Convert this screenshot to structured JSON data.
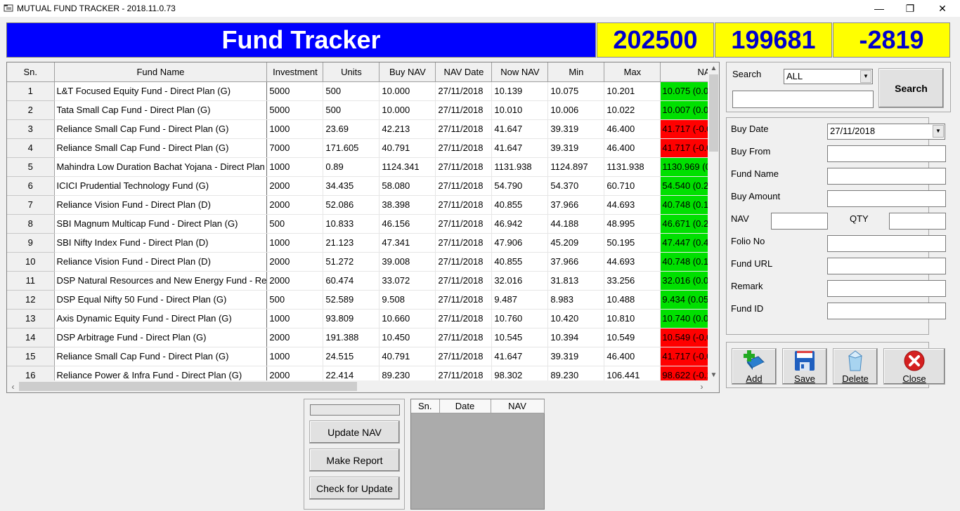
{
  "window": {
    "title": "MUTUAL FUND TRACKER - 2018.11.0.73",
    "controls": {
      "minimize": "—",
      "restore": "❐",
      "close": "✕"
    }
  },
  "banner": {
    "title": "Fund Tracker",
    "total_investment": "202500",
    "current_value": "199681",
    "profit_loss": "-2819"
  },
  "colors": {
    "banner_bg": "#0000ff",
    "stats_bg": "#ffff00",
    "stats_text": "#0000cc",
    "nav_up": "#00e000",
    "nav_down": "#ff0000"
  },
  "grid": {
    "columns": [
      "Sn.",
      "Fund Name",
      "Investment",
      "Units",
      "Buy NAV",
      "NAV Date",
      "Now NAV",
      "Min",
      "Max",
      "NA"
    ],
    "rows": [
      {
        "sn": "1",
        "name": "L&T Focused Equity Fund - Direct Plan (G)",
        "investment": "5000",
        "units": "500",
        "buy_nav": "10.000",
        "nav_date": "27/11/2018",
        "now_nav": "10.139",
        "min": "10.075",
        "max": "10.201",
        "nav_change": "10.075 (0.0",
        "trend": "up"
      },
      {
        "sn": "2",
        "name": "Tata Small Cap Fund - Direct Plan (G)",
        "investment": "5000",
        "units": "500",
        "buy_nav": "10.000",
        "nav_date": "27/11/2018",
        "now_nav": "10.010",
        "min": "10.006",
        "max": "10.022",
        "nav_change": "10.007 (0.0",
        "trend": "up"
      },
      {
        "sn": "3",
        "name": "Reliance Small Cap Fund - Direct Plan (G)",
        "investment": "1000",
        "units": "23.69",
        "buy_nav": "42.213",
        "nav_date": "27/11/2018",
        "now_nav": "41.647",
        "min": "39.319",
        "max": "46.400",
        "nav_change": "41.717 (-0.0",
        "trend": "down"
      },
      {
        "sn": "4",
        "name": "Reliance Small Cap Fund - Direct Plan (G)",
        "investment": "7000",
        "units": "171.605",
        "buy_nav": "40.791",
        "nav_date": "27/11/2018",
        "now_nav": "41.647",
        "min": "39.319",
        "max": "46.400",
        "nav_change": "41.717 (-0.0",
        "trend": "down"
      },
      {
        "sn": "5",
        "name": "Mahindra Low Duration Bachat Yojana - Direct Plan",
        "investment": "1000",
        "units": "0.89",
        "buy_nav": "1124.341",
        "nav_date": "27/11/2018",
        "now_nav": "1131.938",
        "min": "1124.897",
        "max": "1131.938",
        "nav_change": "1130.969 (0",
        "trend": "up"
      },
      {
        "sn": "6",
        "name": "ICICI Prudential Technology Fund (G)",
        "investment": "2000",
        "units": "34.435",
        "buy_nav": "58.080",
        "nav_date": "27/11/2018",
        "now_nav": "54.790",
        "min": "54.370",
        "max": "60.710",
        "nav_change": "54.540 (0.2",
        "trend": "up"
      },
      {
        "sn": "7",
        "name": "Reliance Vision Fund - Direct Plan (D)",
        "investment": "2000",
        "units": "52.086",
        "buy_nav": "38.398",
        "nav_date": "27/11/2018",
        "now_nav": "40.855",
        "min": "37.966",
        "max": "44.693",
        "nav_change": "40.748 (0.1",
        "trend": "up"
      },
      {
        "sn": "8",
        "name": "SBI Magnum Multicap Fund - Direct Plan (G)",
        "investment": "500",
        "units": "10.833",
        "buy_nav": "46.156",
        "nav_date": "27/11/2018",
        "now_nav": "46.942",
        "min": "44.188",
        "max": "48.995",
        "nav_change": "46.671 (0.2",
        "trend": "up"
      },
      {
        "sn": "9",
        "name": "SBI Nifty Index Fund - Direct Plan (D)",
        "investment": "1000",
        "units": "21.123",
        "buy_nav": "47.341",
        "nav_date": "27/11/2018",
        "now_nav": "47.906",
        "min": "45.209",
        "max": "50.195",
        "nav_change": "47.447 (0.4",
        "trend": "up"
      },
      {
        "sn": "10",
        "name": "Reliance Vision Fund - Direct Plan (D)",
        "investment": "2000",
        "units": "51.272",
        "buy_nav": "39.008",
        "nav_date": "27/11/2018",
        "now_nav": "40.855",
        "min": "37.966",
        "max": "44.693",
        "nav_change": "40.748 (0.1",
        "trend": "up"
      },
      {
        "sn": "11",
        "name": "DSP Natural Resources and New Energy Fund - Re",
        "investment": "2000",
        "units": "60.474",
        "buy_nav": "33.072",
        "nav_date": "27/11/2018",
        "now_nav": "32.016",
        "min": "31.813",
        "max": "33.256",
        "nav_change": "32.016 (0.0",
        "trend": "up"
      },
      {
        "sn": "12",
        "name": "DSP Equal Nifty 50 Fund - Direct Plan (G)",
        "investment": "500",
        "units": "52.589",
        "buy_nav": "9.508",
        "nav_date": "27/11/2018",
        "now_nav": "9.487",
        "min": "8.983",
        "max": "10.488",
        "nav_change": "9.434 (0.05",
        "trend": "up"
      },
      {
        "sn": "13",
        "name": "Axis Dynamic Equity Fund - Direct Plan (G)",
        "investment": "1000",
        "units": "93.809",
        "buy_nav": "10.660",
        "nav_date": "27/11/2018",
        "now_nav": "10.760",
        "min": "10.420",
        "max": "10.810",
        "nav_change": "10.740 (0.0",
        "trend": "up"
      },
      {
        "sn": "14",
        "name": "DSP Arbitrage Fund - Direct Plan (G)",
        "investment": "2000",
        "units": "191.388",
        "buy_nav": "10.450",
        "nav_date": "27/11/2018",
        "now_nav": "10.545",
        "min": "10.394",
        "max": "10.549",
        "nav_change": "10.549 (-0.0",
        "trend": "down"
      },
      {
        "sn": "15",
        "name": "Reliance Small Cap Fund - Direct Plan (G)",
        "investment": "1000",
        "units": "24.515",
        "buy_nav": "40.791",
        "nav_date": "27/11/2018",
        "now_nav": "41.647",
        "min": "39.319",
        "max": "46.400",
        "nav_change": "41.717 (-0.0",
        "trend": "down"
      },
      {
        "sn": "16",
        "name": "Reliance Power & Infra Fund - Direct Plan (G)",
        "investment": "2000",
        "units": "22.414",
        "buy_nav": "89.230",
        "nav_date": "27/11/2018",
        "now_nav": "98.302",
        "min": "89.230",
        "max": "106.441",
        "nav_change": "98.622 (-0.1",
        "trend": "down"
      }
    ]
  },
  "search": {
    "label": "Search",
    "filter_selected": "ALL",
    "query_value": "",
    "button_label": "Search"
  },
  "form": {
    "buy_date_label": "Buy Date",
    "buy_date_value": "27/11/2018",
    "buy_from_label": "Buy From",
    "fund_name_label": "Fund Name",
    "buy_amount_label": "Buy Amount",
    "nav_label": "NAV",
    "qty_label": "QTY",
    "folio_label": "Folio No",
    "fund_url_label": "Fund URL",
    "remark_label": "Remark",
    "fund_id_label": "Fund ID"
  },
  "actions": {
    "add": "Add",
    "save": "Save",
    "delete": "Delete",
    "close": "Close"
  },
  "tools": {
    "update_nav": "Update NAV",
    "make_report": "Make Report",
    "check_update": "Check for Update"
  },
  "history": {
    "columns": [
      "Sn.",
      "Date",
      "NAV"
    ]
  },
  "icons": {
    "app": "app-window-icon",
    "add": "book-plus-icon",
    "save": "floppy-disk-icon",
    "delete": "recycle-bin-icon",
    "close": "red-x-circle-icon"
  }
}
